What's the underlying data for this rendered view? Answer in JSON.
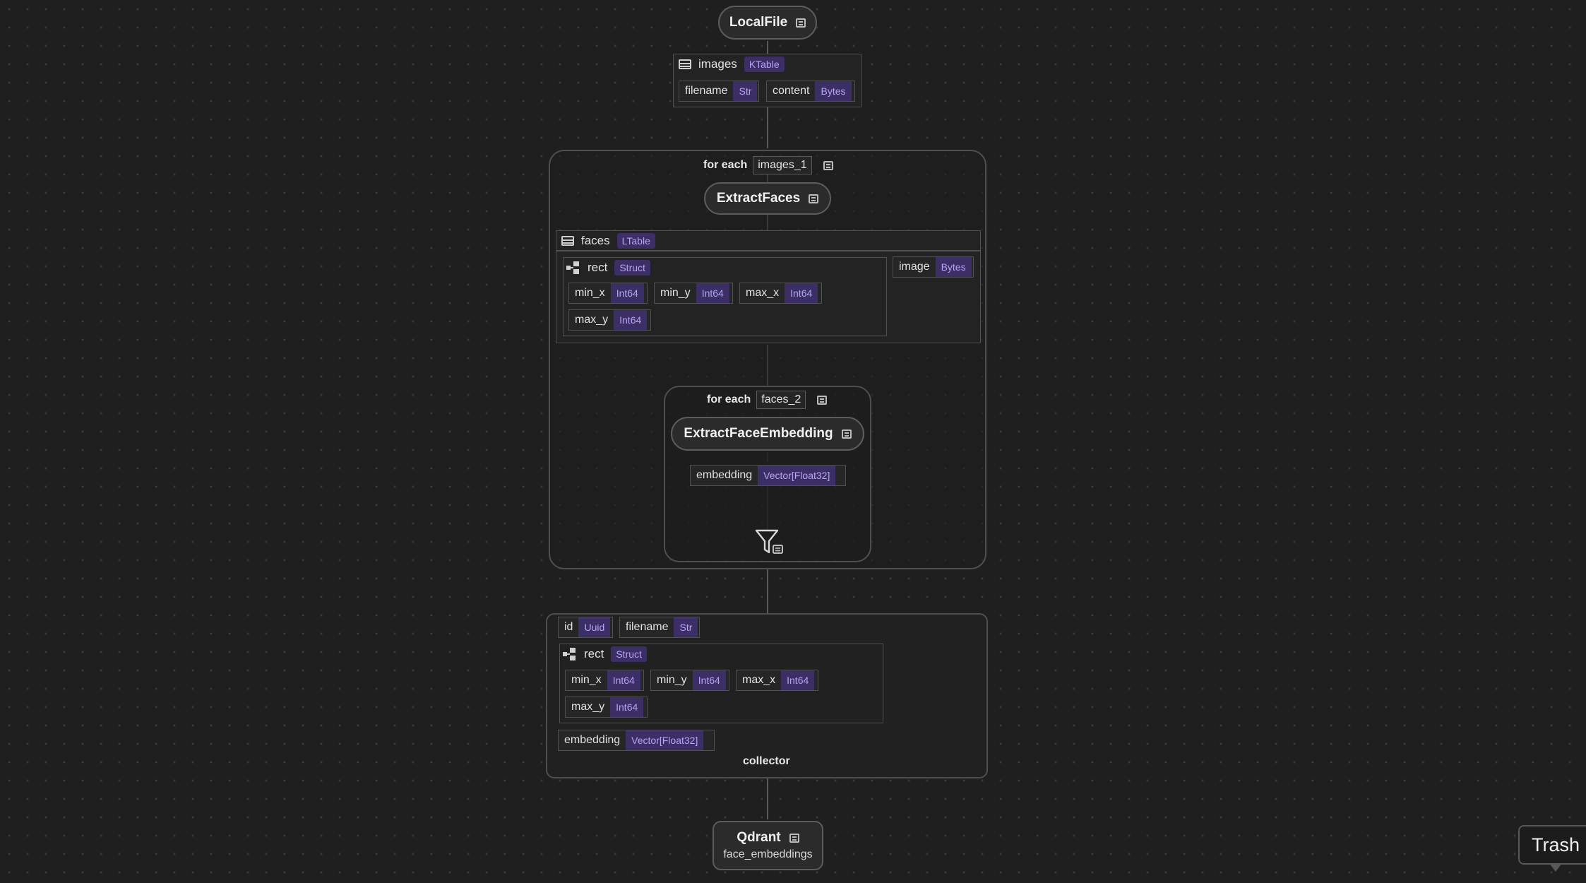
{
  "source": {
    "title": "LocalFile"
  },
  "images_table": {
    "name": "images",
    "type": "KTable",
    "fields": [
      {
        "name": "filename",
        "type": "Str"
      },
      {
        "name": "content",
        "type": "Bytes"
      }
    ]
  },
  "foreach_1": {
    "label": "for each",
    "var": "images_1"
  },
  "extract_faces": {
    "title": "ExtractFaces"
  },
  "faces_table": {
    "name": "faces",
    "type": "LTable",
    "rect": {
      "name": "rect",
      "type": "Struct",
      "fields": [
        {
          "name": "min_x",
          "type": "Int64"
        },
        {
          "name": "min_y",
          "type": "Int64"
        },
        {
          "name": "max_x",
          "type": "Int64"
        },
        {
          "name": "max_y",
          "type": "Int64"
        }
      ]
    },
    "image": {
      "name": "image",
      "type": "Bytes"
    }
  },
  "foreach_2": {
    "label": "for each",
    "var": "faces_2"
  },
  "extract_embedding": {
    "title": "ExtractFaceEmbedding"
  },
  "embedding_out": {
    "name": "embedding",
    "type": "Vector[Float32]"
  },
  "collector": {
    "label": "collector",
    "id": {
      "name": "id",
      "type": "Uuid"
    },
    "filename": {
      "name": "filename",
      "type": "Str"
    },
    "rect": {
      "name": "rect",
      "type": "Struct",
      "fields": [
        {
          "name": "min_x",
          "type": "Int64"
        },
        {
          "name": "min_y",
          "type": "Int64"
        },
        {
          "name": "max_x",
          "type": "Int64"
        },
        {
          "name": "max_y",
          "type": "Int64"
        }
      ]
    },
    "embedding": {
      "name": "embedding",
      "type": "Vector[Float32]"
    }
  },
  "target": {
    "title": "Qdrant",
    "subtitle": "face_embeddings"
  },
  "trash": {
    "label": "Trash"
  }
}
